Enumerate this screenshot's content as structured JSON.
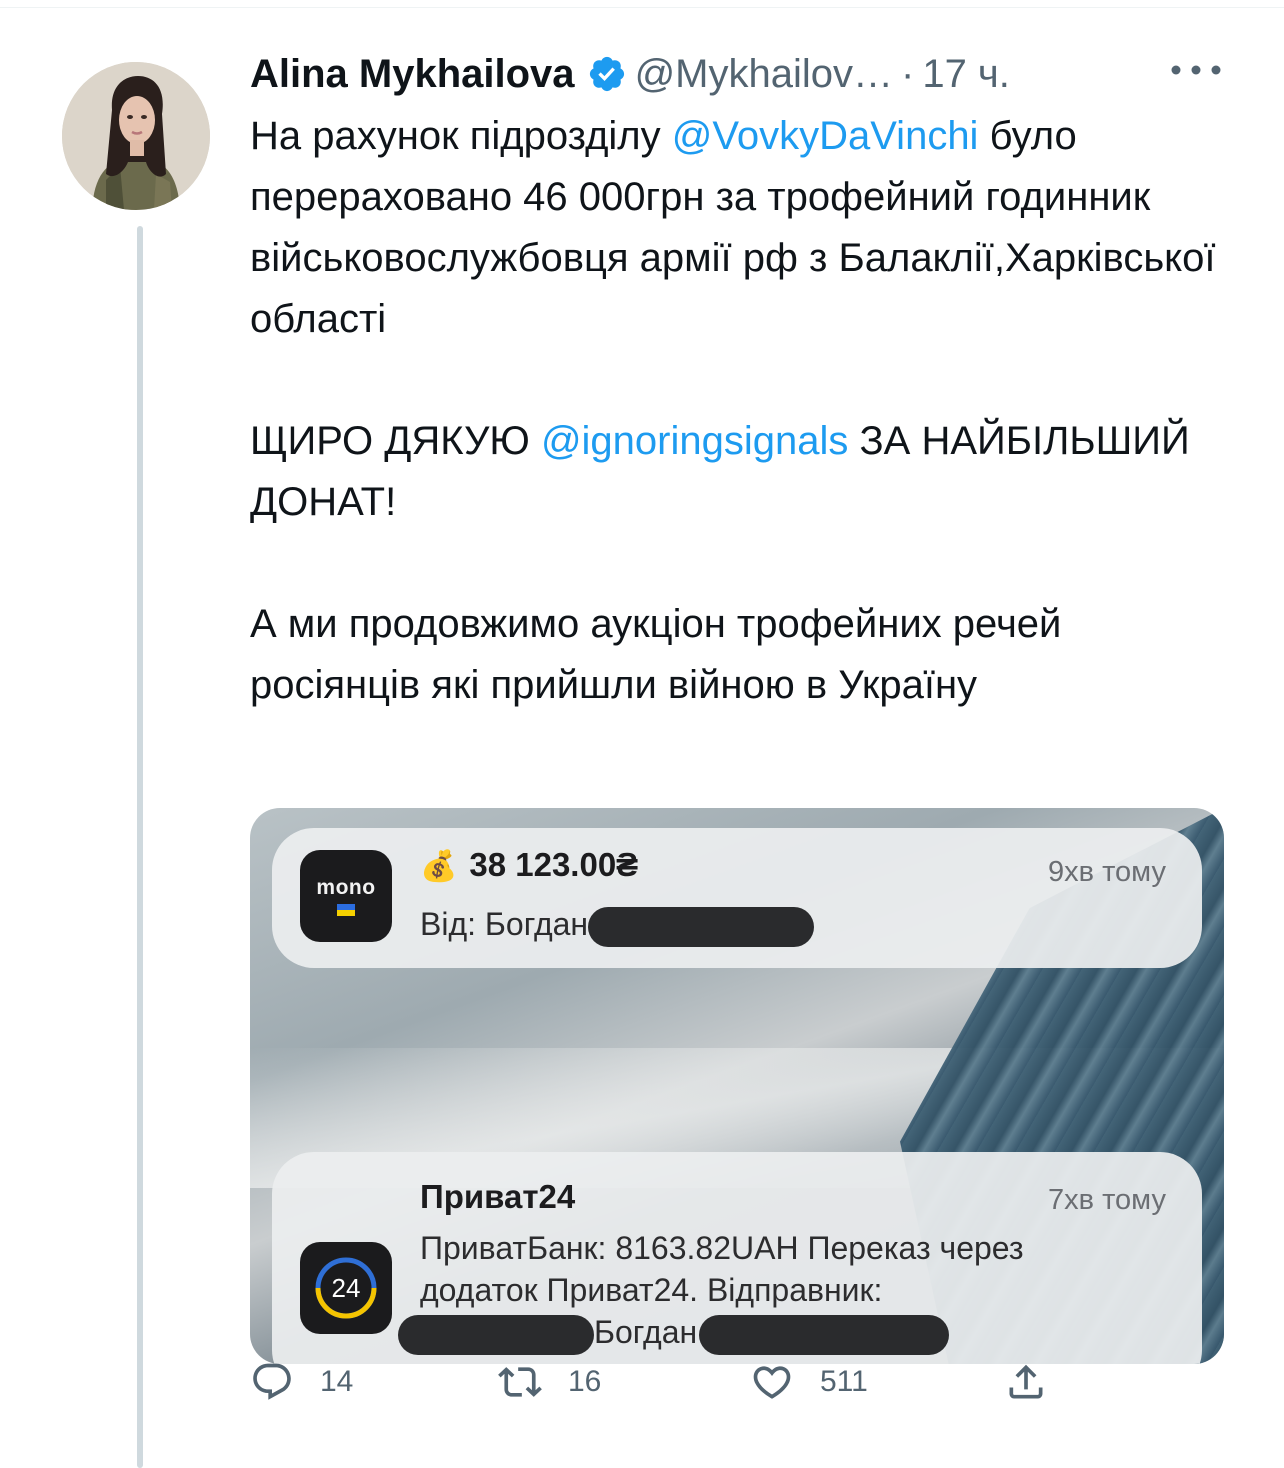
{
  "tweet": {
    "author_name": "Alina Mykhailova",
    "handle": "@Mykhailov…",
    "separator": "·",
    "time": "17 ч.",
    "text": {
      "p1_before": "На рахунок підрозділу ",
      "p1_mention": "@VovkyDaVinchi",
      "p1_after": " було перераховано 46 000грн за трофейний годинник військовослужбовця армії рф з Балаклії,Харківської області",
      "p2_before": "ЩИРО ДЯКУЮ ",
      "p2_mention": "@ignoringsignals",
      "p2_after": " ЗА НАЙБІЛЬШИЙ ДОНАТ!",
      "p3": "А ми продовжимо аукціон трофейних речей росіянців які прийшли війною в Україну"
    }
  },
  "media": {
    "notif_mono": {
      "app_label": "mono",
      "emoji": "💰",
      "amount": "38 123.00₴",
      "time": "9хв тому",
      "from": "Від: Богдан"
    },
    "notif_privat": {
      "title": "Приват24",
      "time": "7хв тому",
      "app_label": "24",
      "line1": "ПриватБанк: 8163.82UAH Переказ через",
      "line2": "додаток Приват24. Відправник:",
      "line3": "Богдан"
    }
  },
  "actions": {
    "reply_count": "14",
    "retweet_count": "16",
    "like_count": "511"
  },
  "colors": {
    "link": "#1d9bf0",
    "secondary_text": "#536471",
    "verified": "#1d9bf0"
  }
}
